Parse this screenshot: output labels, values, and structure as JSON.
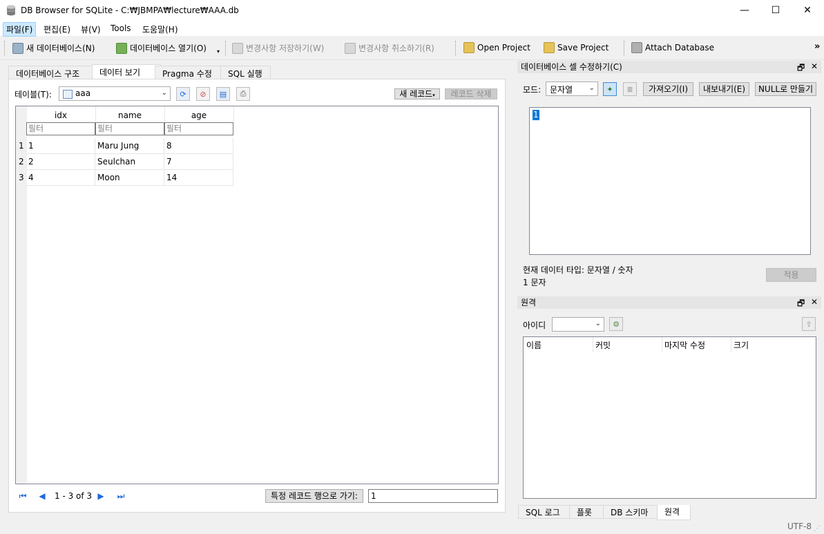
{
  "window": {
    "title": "DB Browser for SQLite - C:₩JBMPA₩lecture₩AAA.db",
    "minimize": "—",
    "maximize": "☐",
    "close": "✕"
  },
  "menu": [
    "파일(F)",
    "편집(E)",
    "뷰(V)",
    "Tools",
    "도움말(H)"
  ],
  "toolbar": {
    "new_db": "새 데이터베이스(N)",
    "open_db": "데이터베이스 열기(O)",
    "write_changes": "변경사항 저장하기(W)",
    "revert_changes": "변경사항 취소하기(R)",
    "open_project": "Open Project",
    "save_project": "Save Project",
    "attach_db": "Attach Database",
    "overflow": "»"
  },
  "tabs": [
    "데이터베이스 구조",
    "데이터 보기",
    "Pragma 수정",
    "SQL 실행"
  ],
  "browse": {
    "table_label": "테이블(T):",
    "table_value": "aaa",
    "new_record": "새 레코드",
    "delete_record": "레코드 삭제",
    "columns": [
      "idx",
      "name",
      "age"
    ],
    "filter_placeholder": "필터",
    "rows": [
      {
        "n": "1",
        "cells": [
          "1",
          "Maru Jung",
          "8"
        ]
      },
      {
        "n": "2",
        "cells": [
          "2",
          "Seulchan",
          "7"
        ]
      },
      {
        "n": "3",
        "cells": [
          "4",
          "Moon",
          "14"
        ]
      }
    ],
    "record_range": "1 - 3 of 3",
    "goto_label": "특정 레코드 행으로 가기:",
    "goto_value": "1"
  },
  "edit_cell": {
    "title": "데이터베이스 셀 수정하기(C)",
    "mode_label": "모드:",
    "mode_value": "문자열",
    "import": "가져오기(I)",
    "export": "내보내기(E)",
    "set_null": "NULL로 만들기",
    "content": "1",
    "type_info": "현재 데이터 타입: 문자열 / 숫자",
    "size_info": "1 문자",
    "apply": "적용"
  },
  "remote": {
    "title": "원격",
    "id_label": "아이디",
    "columns": [
      "이름",
      "커밋",
      "마지막 수정",
      "크기"
    ]
  },
  "bottom_tabs": [
    "SQL 로그",
    "플롯",
    "DB 스키마",
    "원격"
  ],
  "status": {
    "encoding": "UTF-8"
  },
  "colors": {
    "accent": "#1e6bd6",
    "menu_highlight": "#cce8ff",
    "selection": "#0078d7"
  }
}
